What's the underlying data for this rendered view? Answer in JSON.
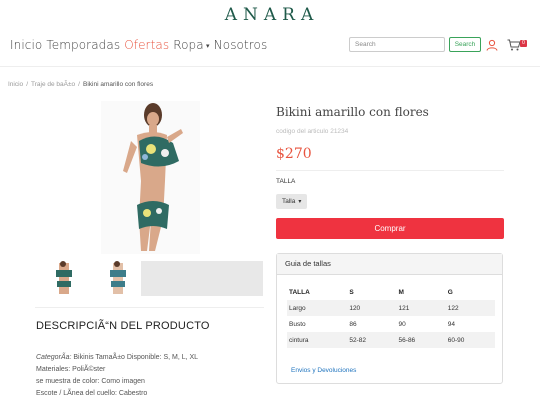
{
  "brand": {
    "logo_text": "ANARA"
  },
  "nav": {
    "items": [
      {
        "label": "Inicio"
      },
      {
        "label": "Temporadas"
      },
      {
        "label": "Ofertas"
      },
      {
        "label": "Ropa"
      },
      {
        "label": "Nosotros"
      }
    ],
    "active_index": 2
  },
  "search": {
    "placeholder": "Search",
    "button_label": "Search"
  },
  "cart": {
    "count": "0"
  },
  "breadcrumb": [
    "Inicio",
    "Traje de baÃ±o",
    "Bikini amarillo con flores"
  ],
  "product": {
    "title": "Bikini amarillo con flores",
    "code": "codigo del articulo 21234",
    "price": "$270",
    "size_label": "TALLA",
    "size_select": "Talla",
    "buy_label": "Comprar"
  },
  "description": {
    "title": "DESCRIPCIÃ“N DEL PRODUCTO",
    "lines": [
      {
        "label": "CategorÃ­a:",
        "text": " Bikinis TamaÃ±o Disponible: S, M, L, XL"
      },
      {
        "label": "",
        "text": "Materiales: PoliÃ©ster"
      },
      {
        "label": "",
        "text": "se muestra de color: Como imagen"
      },
      {
        "label": "",
        "text": "Escote / LÃ­nea del cuello: Cabestro"
      }
    ]
  },
  "size_guide": {
    "title": "Guia de tallas",
    "headers": [
      "TALLA",
      "S",
      "M",
      "G"
    ],
    "rows": [
      [
        "Largo",
        "120",
        "121",
        "122"
      ],
      [
        "Busto",
        "86",
        "90",
        "94"
      ],
      [
        "cintura",
        "52-82",
        "56-86",
        "60-90"
      ]
    ],
    "link": "Envios y Devoluciones"
  },
  "colors": {
    "accent": "#e8543f",
    "buy": "#ef3340",
    "search_green": "#3aa35a",
    "logo": "#1f5a4a"
  }
}
